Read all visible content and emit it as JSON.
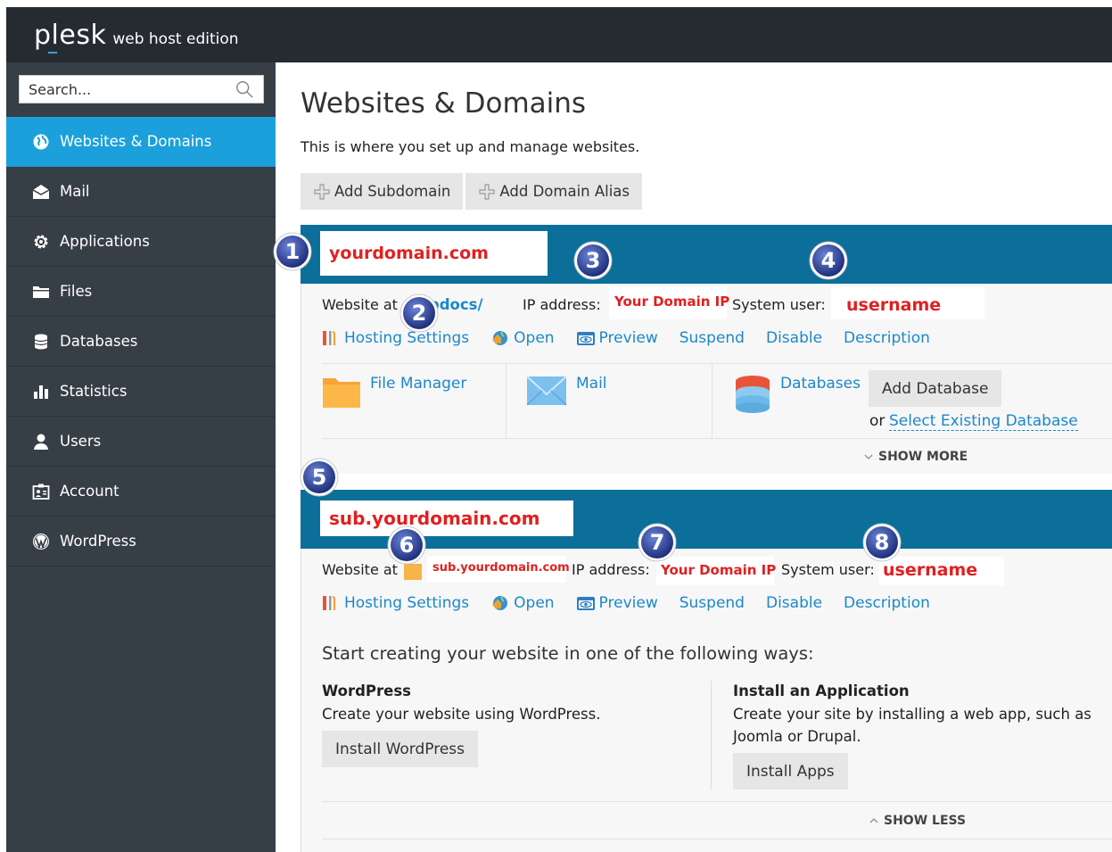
{
  "brand": {
    "logo": "plesk",
    "edition": "web host edition"
  },
  "search": {
    "placeholder": "Search..."
  },
  "sidebar": {
    "items": [
      {
        "label": "Websites & Domains",
        "icon": "globe-icon",
        "active": true
      },
      {
        "label": "Mail",
        "icon": "envelope-icon"
      },
      {
        "label": "Applications",
        "icon": "gear-icon"
      },
      {
        "label": "Files",
        "icon": "folder-icon"
      },
      {
        "label": "Databases",
        "icon": "database-icon"
      },
      {
        "label": "Statistics",
        "icon": "bar-chart-icon"
      },
      {
        "label": "Users",
        "icon": "user-icon"
      },
      {
        "label": "Account",
        "icon": "account-card-icon"
      },
      {
        "label": "WordPress",
        "icon": "wordpress-icon"
      }
    ]
  },
  "main": {
    "title": "Websites & Domains",
    "description": "This is where you set up and manage websites.",
    "toolbar": {
      "add_subdomain": "Add Subdomain",
      "add_domain_alias": "Add Domain Alias"
    }
  },
  "domains": [
    {
      "name": "yourdomain.com",
      "website_at_label": "Website at",
      "website_at_value": "httpdocs/",
      "website_at_visible": "tpdocs/",
      "ip_label": "IP address:",
      "ip_value": "Your Domain IP",
      "user_label": "System user:",
      "user_value": "username",
      "actions": [
        "Hosting Settings",
        "Open",
        "Preview",
        "Suspend",
        "Disable",
        "Description"
      ],
      "tools": {
        "file_manager": "File Manager",
        "mail": "Mail",
        "databases": "Databases",
        "add_database": "Add Database",
        "or": "or",
        "select_existing": "Select Existing Database"
      },
      "toggle": "SHOW MORE"
    },
    {
      "name": "sub.yourdomain.com",
      "website_at_label": "Website at",
      "website_at_value": "sub.yourdomain.com",
      "ip_label": "IP address:",
      "ip_value": "Your Domain IP",
      "user_label": "System user:",
      "user_value": "username",
      "actions": [
        "Hosting Settings",
        "Open",
        "Preview",
        "Suspend",
        "Disable",
        "Description"
      ],
      "start_title": "Start creating your website in one of the following ways:",
      "wordpress": {
        "title": "WordPress",
        "desc": "Create your website using WordPress.",
        "button": "Install WordPress"
      },
      "install_app": {
        "title": "Install an Application",
        "desc_line1": "Create your site by installing a web app, such as",
        "desc_line2": "Joomla or Drupal.",
        "button": "Install Apps"
      },
      "toggle": "SHOW LESS"
    }
  ],
  "markers": [
    "1",
    "2",
    "3",
    "4",
    "5",
    "6",
    "7",
    "8"
  ],
  "colors": {
    "topbar": "#262b31",
    "sidebar": "#363e46",
    "active": "#1ba0db",
    "domain_bar": "#0b6f9a",
    "link": "#1b88c8",
    "annotation_red": "#e02020"
  }
}
